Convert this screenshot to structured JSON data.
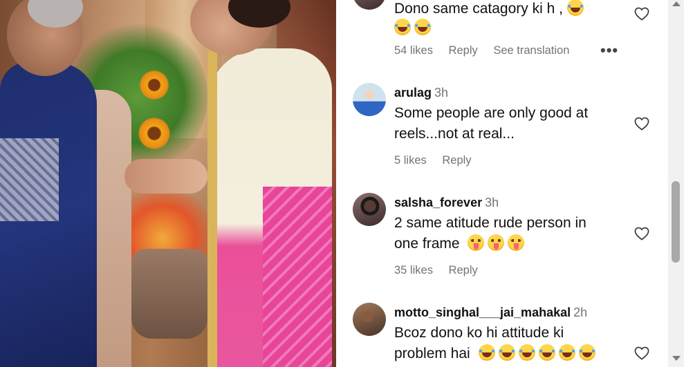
{
  "media": {
    "description_icon": "video-frame"
  },
  "comments": [
    {
      "username": "",
      "time": "",
      "text": "Dono same catagory ki h ,",
      "emojis_line1": [
        "laugh"
      ],
      "emojis_line2": [
        "laugh",
        "laugh"
      ],
      "likes": "54 likes",
      "reply": "Reply",
      "translate": "See translation",
      "more": "•••"
    },
    {
      "username": "arulag",
      "time": "3h",
      "text_line1": "Some people are only good at",
      "text_line2": "reels...not at real...",
      "likes": "5 likes",
      "reply": "Reply"
    },
    {
      "username": "salsha_forever",
      "time": "3h",
      "text_line1": "2 same atitude rude person in",
      "text_line2": "one frame",
      "emojis": [
        "wink",
        "wink",
        "wink"
      ],
      "likes": "35 likes",
      "reply": "Reply"
    },
    {
      "username": "motto_singhal___jai_mahakal",
      "time": "2h",
      "text_line1": "Bcoz dono ko hi attitude ki",
      "text_line2": "problem hai",
      "emojis": [
        "laugh",
        "laugh",
        "laugh",
        "laugh",
        "laugh",
        "laugh"
      ]
    }
  ],
  "icons": {
    "like": "heart-icon",
    "more": "more-options-icon",
    "scroll_up": "arrow-up-icon",
    "scroll_down": "arrow-down-icon"
  },
  "colors": {
    "muted_text": "#737373",
    "text": "#111111",
    "scroll_thumb": "#a8a8a8"
  }
}
